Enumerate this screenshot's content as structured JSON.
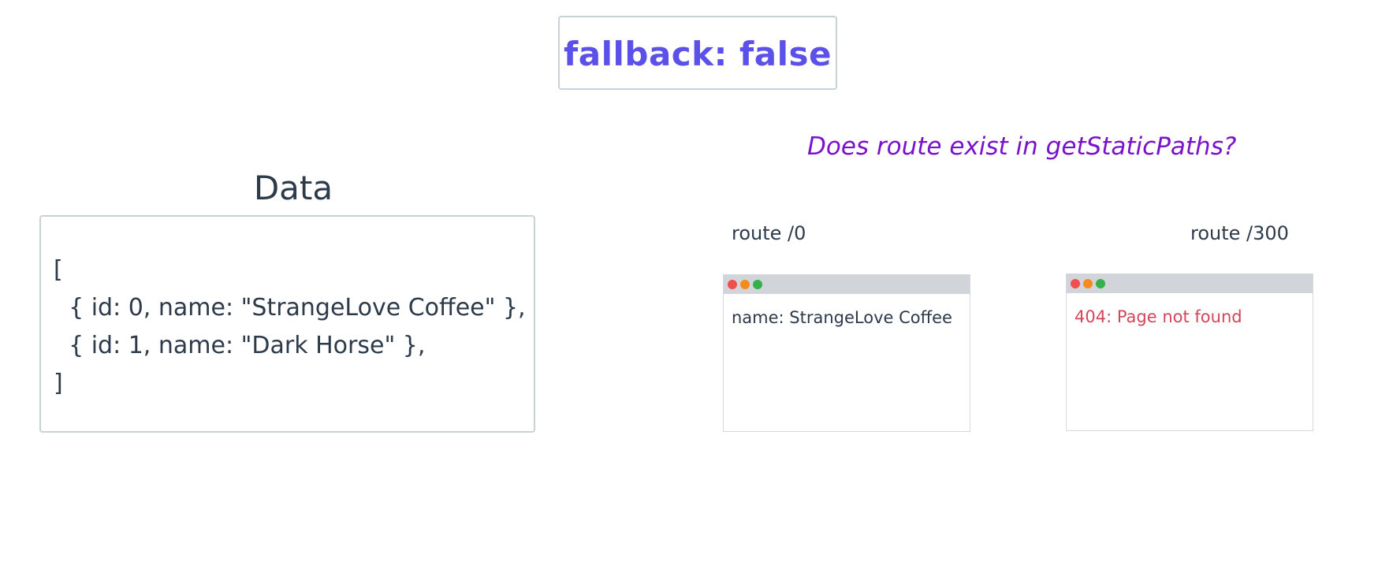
{
  "header": {
    "title": "fallback: false"
  },
  "question": "Does route exist in getStaticPaths?",
  "data_panel": {
    "title": "Data",
    "lines": [
      "[",
      "  { id: 0, name: \"StrangeLove Coffee\" },",
      "  { id: 1, name: \"Dark Horse\" },",
      "]"
    ]
  },
  "routes": [
    {
      "label": "route /0",
      "content": "name: StrangeLove Coffee",
      "status": "ok"
    },
    {
      "label": "route /300",
      "content": "404: Page not found",
      "status": "error"
    }
  ],
  "colors": {
    "title": "#5b50e8",
    "question": "#7a12c9",
    "text": "#2d3a4a",
    "error": "#d3455b",
    "window_bar": "#d1d5da",
    "dot_red": "#f04f4f",
    "dot_orange": "#f58b1f",
    "dot_green": "#34b14a"
  }
}
